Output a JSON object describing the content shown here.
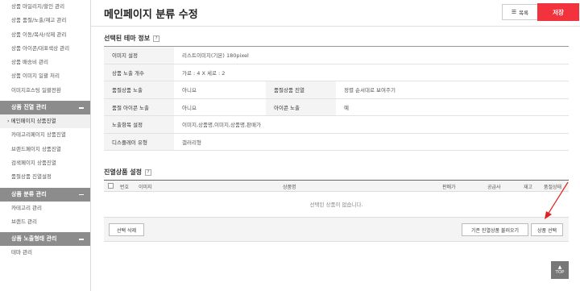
{
  "sidebar": {
    "product_items": [
      "상품 마일리지/할인 관리",
      "상품 품절/노출/재고 관리",
      "상품 이동/복사/삭제 관리",
      "상품 아이콘/대표색상 관리",
      "상품 배송비 관리",
      "상품 이미지 일괄 처리",
      "이미지호스팅 일괄전환"
    ],
    "display_header": "상품 진열 관리",
    "display_items": [
      "메인페이지 상품진열",
      "카테고리페이지 상품진열",
      "브랜드페이지 상품진열",
      "검색페이지 상품진열",
      "품절상품 진열설정"
    ],
    "category_header": "상품 분류 관리",
    "category_items": [
      "카테고리 관리",
      "브랜드 관리"
    ],
    "exposure_header": "상품 노출형태 관리",
    "exposure_items": [
      "테마 관리"
    ]
  },
  "header": {
    "title": "메인페이지 분류 수정",
    "list_label": "목록",
    "save_label": "저장"
  },
  "theme_info": {
    "title": "선택된 테마 정보",
    "help": "?",
    "rows": {
      "image_setting_label": "이미지 설정",
      "image_setting_value": "리스트이미지(기본) 180pixel",
      "exposure_count_label": "상품 노출 개수",
      "exposure_count_value": "가로 : 4 X 세로 : 2",
      "soldout_expose_label": "품절상품 노출",
      "soldout_expose_value": "아니요",
      "soldout_display_label": "품절상품 진열",
      "soldout_display_value": "정렬 순서대로 보여주기",
      "soldout_icon_label": "품절 아이콘 노출",
      "soldout_icon_value": "아니요",
      "icon_expose_label": "아이콘 노출",
      "icon_expose_value": "예",
      "expose_items_label": "노출항목 설정",
      "expose_items_value": "이미지,상품명,이미지,상품명,판매가",
      "display_type_label": "디스플레이 유형",
      "display_type_value": "갤러리형"
    }
  },
  "products": {
    "title": "진열상품 설정",
    "help": "?",
    "columns": {
      "no": "번호",
      "image": "이미지",
      "name": "상품명",
      "price": "판매가",
      "supplier": "공급사",
      "stock": "재고",
      "status": "품절상태"
    },
    "empty_text": "선택된 상품이 없습니다.",
    "delete_label": "선택 삭제",
    "load_label": "기존 진열상품 불러오기",
    "select_label": "상품 선택"
  },
  "top_label": "TOP",
  "colors": {
    "accent": "#f2323c",
    "sidebar_header": "#8c8c8c"
  }
}
